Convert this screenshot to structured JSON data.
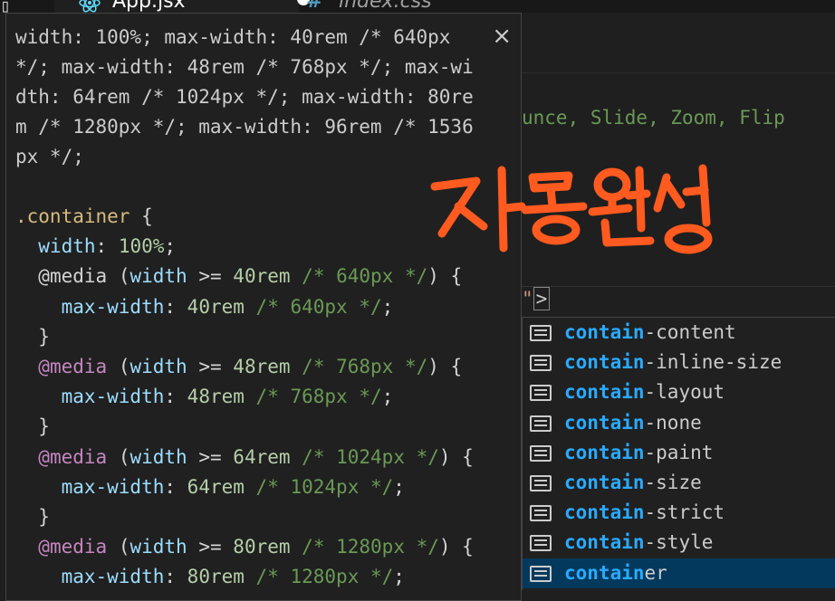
{
  "tabs": [
    {
      "name": "App.jsx",
      "icon": "react-icon",
      "modified": true
    },
    {
      "name": "index.css",
      "icon": "css-hash-icon"
    }
  ],
  "editor": {
    "right_fragment": "unce, Slide, Zoom, Flip",
    "cursor_quote": "\"",
    "cursor_char": ">"
  },
  "hover": {
    "description": "width: 100%; max-width: 40rem /* 640px */; max-width: 48rem /* 768px */; max-width: 64rem /* 1024px */; max-width: 80rem /* 1280px */; max-width: 96rem /* 1536px */;",
    "close_glyph": "×",
    "selector": ".container",
    "open_brace": "{",
    "width_prop": "width",
    "width_value": "100%",
    "media_keyword": "@media",
    "media_feature": "width",
    "media_operator": ">=",
    "max_width_prop": "max-width",
    "breakpoints": [
      {
        "rem": "40rem",
        "comment": "/* 640px */"
      },
      {
        "rem": "48rem",
        "comment": "/* 768px */"
      },
      {
        "rem": "64rem",
        "comment": "/* 1024px */"
      },
      {
        "rem": "80rem",
        "comment": "/* 1280px */"
      }
    ]
  },
  "annotation": {
    "text": "자동완성",
    "color": "#ff5a1f"
  },
  "suggest": {
    "query": "contain",
    "items": [
      {
        "match": "contain",
        "rest": "-content",
        "selected": false
      },
      {
        "match": "contain",
        "rest": "-inline-size",
        "selected": false
      },
      {
        "match": "contain",
        "rest": "-layout",
        "selected": false
      },
      {
        "match": "contain",
        "rest": "-none",
        "selected": false
      },
      {
        "match": "contain",
        "rest": "-paint",
        "selected": false
      },
      {
        "match": "contain",
        "rest": "-size",
        "selected": false
      },
      {
        "match": "contain",
        "rest": "-strict",
        "selected": false
      },
      {
        "match": "contain",
        "rest": "-style",
        "selected": false
      },
      {
        "match": "contain",
        "rest": "er",
        "selected": true
      }
    ],
    "item_icon": "keyword-icon"
  },
  "colors": {
    "match": "#2aaaff",
    "selection": "#04395e",
    "selector": "#d7ba7d",
    "property": "#9cdcfe",
    "number": "#b5cea8",
    "comment": "#6a9955",
    "at_rule": "#c586c0"
  }
}
